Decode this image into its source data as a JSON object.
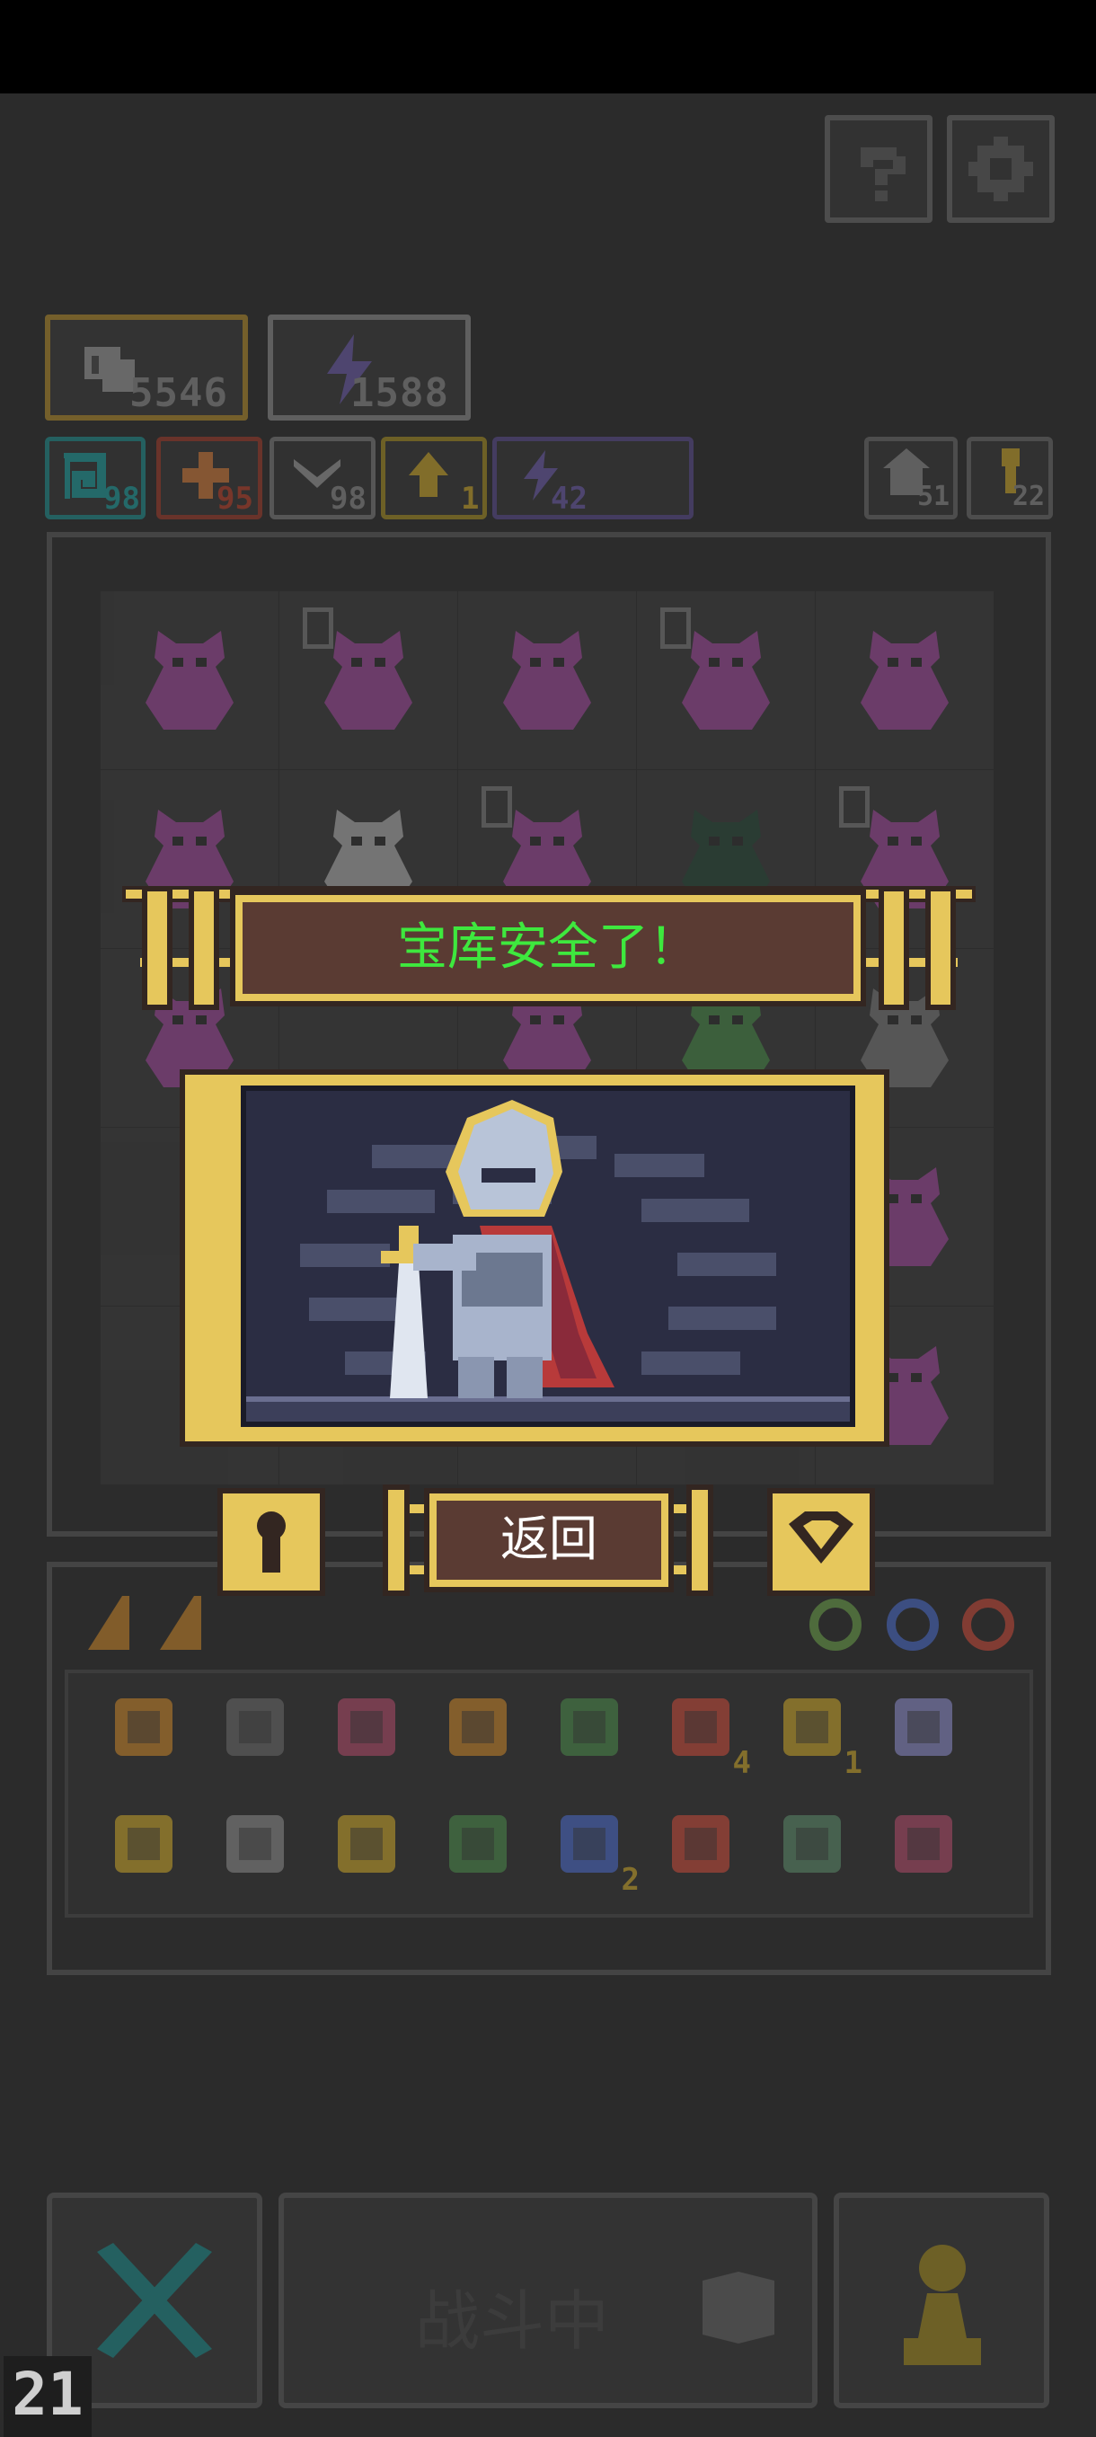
{
  "colors": {
    "background": "#2b2b2b",
    "gold_frame": "#e6c75c",
    "banner_fill": "#5a3b33",
    "title_text": "#3ee83e",
    "scene_bg": "#2b2d43"
  },
  "top_buttons": {
    "help_icon": "question-icon",
    "settings_icon": "gear-icon"
  },
  "stats": {
    "attack": {
      "icon": "fist-icon",
      "value": "5546"
    },
    "energy": {
      "icon": "lightning-icon",
      "value": "1588"
    }
  },
  "resources": [
    {
      "icon": "swirl-icon",
      "value": "98",
      "color": "#1f8c8c"
    },
    {
      "icon": "cross-icon",
      "value": "95",
      "color": "#9c3a2a"
    },
    {
      "icon": "wing-icon",
      "value": "98",
      "color": "#7a7a7a"
    },
    {
      "icon": "up-arrow-icon",
      "value": "1",
      "color": "#a48c22"
    },
    {
      "icon": "lightning-icon",
      "value": "42",
      "color": "#5a4a8c"
    }
  ],
  "right_counters": [
    {
      "icon": "house-icon",
      "value": "51"
    },
    {
      "icon": "key-icon",
      "value": "22"
    }
  ],
  "board": {
    "cells": [
      {
        "creature": "demon",
        "lvl": false
      },
      {
        "creature": "demon",
        "lvl": true
      },
      {
        "creature": "demon",
        "lvl": false
      },
      {
        "creature": "demon",
        "lvl": true
      },
      {
        "creature": "demon",
        "lvl": false
      },
      {
        "creature": "demon",
        "lvl": false
      },
      {
        "creature": "skeleton",
        "lvl": false
      },
      {
        "creature": "demon",
        "lvl": true
      },
      {
        "creature": "shade",
        "lvl": false
      },
      {
        "creature": "demon",
        "lvl": true
      },
      {
        "creature": "demon",
        "lvl": false
      },
      {
        "creature": "empty",
        "lvl": false
      },
      {
        "creature": "demon",
        "lvl": false
      },
      {
        "creature": "goblin",
        "lvl": false
      },
      {
        "creature": "ghost",
        "lvl": false
      },
      {
        "creature": "empty",
        "lvl": false
      },
      {
        "creature": "empty",
        "lvl": false
      },
      {
        "creature": "empty",
        "lvl": false
      },
      {
        "creature": "empty",
        "lvl": false
      },
      {
        "creature": "demon",
        "lvl": false
      },
      {
        "creature": "empty",
        "lvl": false
      },
      {
        "creature": "empty",
        "lvl": false
      },
      {
        "creature": "empty",
        "lvl": false
      },
      {
        "creature": "empty",
        "lvl": false
      },
      {
        "creature": "demon",
        "lvl": false
      }
    ]
  },
  "modal": {
    "title": "宝库安全了！",
    "back_label": "返回",
    "hero_icon": "knight-icon",
    "left_icon": "keyhole-icon",
    "right_icon": "heart-shield-icon"
  },
  "inventory": {
    "row1": [
      {
        "icon": "armor-icon",
        "count": ""
      },
      {
        "icon": "shield-icon",
        "count": ""
      },
      {
        "icon": "helmet-icon",
        "count": ""
      },
      {
        "icon": "gem-icon",
        "count": ""
      },
      {
        "icon": "map-icon",
        "count": ""
      },
      {
        "icon": "mask-icon",
        "count": "4"
      },
      {
        "icon": "potion-icon",
        "count": "1"
      },
      {
        "icon": "dagger-icon",
        "count": ""
      }
    ],
    "row2": [
      {
        "icon": "staff-icon",
        "count": ""
      },
      {
        "icon": "lever-icon",
        "count": ""
      },
      {
        "icon": "trident-icon",
        "count": ""
      },
      {
        "icon": "rune-icon",
        "count": ""
      },
      {
        "icon": "hourglass-icon",
        "count": "2"
      },
      {
        "icon": "arrow-icon",
        "count": ""
      },
      {
        "icon": "bell-icon",
        "count": ""
      },
      {
        "icon": "spear-icon",
        "count": ""
      }
    ]
  },
  "bottom": {
    "battle_label": "战斗中",
    "left_icon": "crossed-swords-icon",
    "right_icon": "pawn-icon",
    "corner_counter": "21"
  }
}
